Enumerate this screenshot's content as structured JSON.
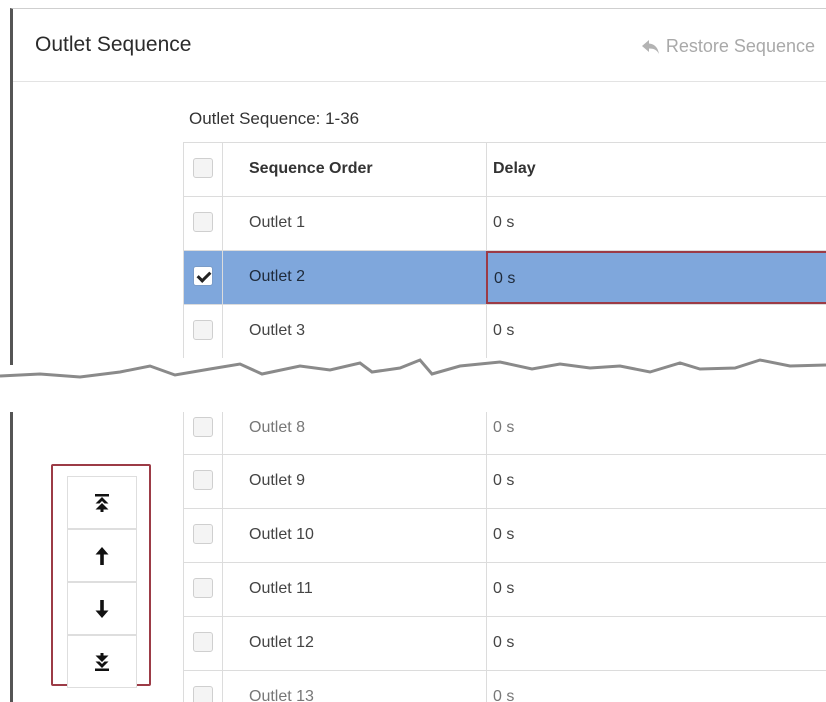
{
  "header": {
    "title": "Outlet Sequence",
    "restore_label": "Restore Sequence",
    "restore_icon": "reply-arrow-icon"
  },
  "sequence_label": "Outlet Sequence: 1-36",
  "table": {
    "columns": [
      "Sequence Order",
      "Delay"
    ],
    "rows_top": [
      {
        "name": "Outlet 1",
        "delay": "0 s",
        "checked": false,
        "selected": false
      },
      {
        "name": "Outlet 2",
        "delay": "0 s",
        "checked": true,
        "selected": true
      },
      {
        "name": "Outlet 3",
        "delay": "0 s",
        "checked": false,
        "selected": false
      }
    ],
    "rows_bottom": [
      {
        "name": "Outlet 8",
        "delay": "0 s"
      },
      {
        "name": "Outlet 9",
        "delay": "0 s"
      },
      {
        "name": "Outlet 10",
        "delay": "0 s"
      },
      {
        "name": "Outlet 11",
        "delay": "0 s"
      },
      {
        "name": "Outlet 12",
        "delay": "0 s"
      },
      {
        "name": "Outlet 13",
        "delay": "0 s"
      }
    ]
  },
  "move_buttons": [
    {
      "icon": "move-to-top-icon"
    },
    {
      "icon": "move-up-icon"
    },
    {
      "icon": "move-down-icon"
    },
    {
      "icon": "move-to-bottom-icon"
    }
  ],
  "colors": {
    "selected_row": "#7fa7dc",
    "highlight_border": "#9c3b46",
    "muted_text": "#a9a9a9"
  }
}
